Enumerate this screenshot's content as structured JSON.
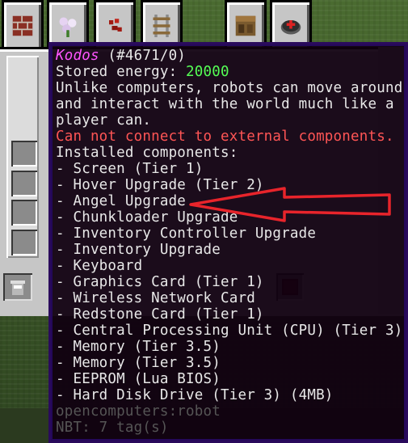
{
  "tabs": [
    {
      "icon": "red-block-icon",
      "color": "#8a2f24"
    },
    {
      "icon": "flower-icon",
      "color": "#d9c2e8"
    },
    {
      "icon": "redstone-icon",
      "color": "#a11a12"
    },
    {
      "icon": "rail-icon",
      "color": "#8a6a3a"
    },
    {
      "icon": "crafting-table-icon",
      "color": "#7a5a2e"
    },
    {
      "icon": "robot-device-icon",
      "color": "#5a5a5a"
    }
  ],
  "tooltip": {
    "name": "Kodos",
    "id": " (#4671/0)",
    "energy_label": "Stored energy: ",
    "energy_value": "20000",
    "description": [
      "Unlike computers, robots can move around",
      "and interact with the world much like a",
      "player can."
    ],
    "warning": "Can not connect to external components.",
    "components_header": "Installed components:",
    "components": [
      "- Screen (Tier 1)",
      "- Hover Upgrade (Tier 2)",
      "- Angel Upgrade",
      "- Chunkloader Upgrade",
      "- Inventory Controller Upgrade",
      "- Inventory Upgrade",
      "- Keyboard",
      "- Graphics Card (Tier 1)",
      "- Wireless Network Card",
      "- Redstone Card (Tier 1)",
      "- Central Processing Unit (CPU) (Tier 3)",
      "- Memory (Tier 3.5)",
      "- Memory (Tier 3.5)",
      "- EEPROM (Lua BIOS)",
      "- Hard Disk Drive (Tier 3) (4MB)"
    ],
    "registry_name": "opencomputers:robot",
    "nbt": "NBT: 7 tag(s)"
  },
  "annotation": {
    "color": "#e8242b",
    "points_to": "- Angel Upgrade"
  }
}
